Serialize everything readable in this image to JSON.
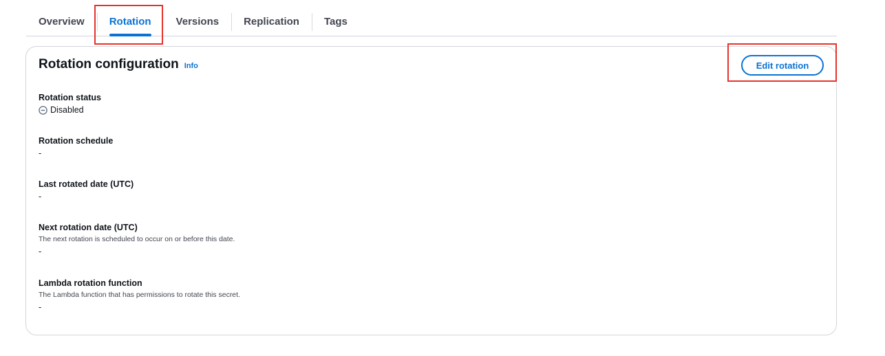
{
  "tabs": [
    {
      "label": "Overview"
    },
    {
      "label": "Rotation",
      "active": true
    },
    {
      "label": "Versions"
    },
    {
      "label": "Replication"
    },
    {
      "label": "Tags"
    }
  ],
  "rotation_config": {
    "title": "Rotation configuration",
    "info_label": "Info",
    "edit_button_label": "Edit rotation",
    "fields": {
      "status": {
        "label": "Rotation status",
        "value": "Disabled",
        "icon": "disabled-circle-icon"
      },
      "schedule": {
        "label": "Rotation schedule",
        "value": "-"
      },
      "last_rotated": {
        "label": "Last rotated date (UTC)",
        "value": "-"
      },
      "next_rotation": {
        "label": "Next rotation date (UTC)",
        "description": "The next rotation is scheduled to occur on or before this date.",
        "value": "-"
      },
      "lambda_function": {
        "label": "Lambda rotation function",
        "description": "The Lambda function that has permissions to rotate this secret.",
        "value": "-"
      }
    }
  },
  "colors": {
    "accent": "#0972d3",
    "highlight": "#e5332a",
    "border": "#d1d5db",
    "text": "#0f141a",
    "muted_text": "#424650"
  }
}
